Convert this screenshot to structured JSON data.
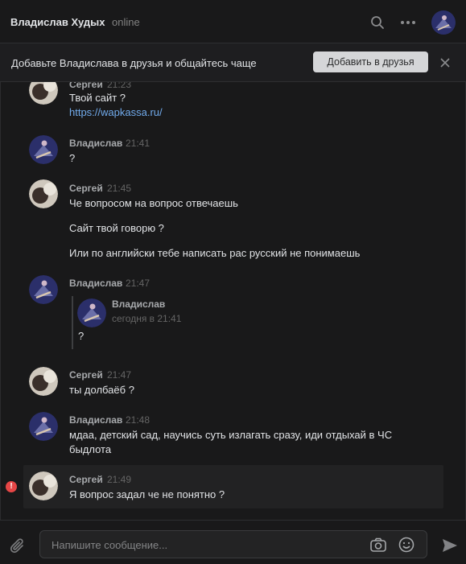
{
  "header": {
    "name": "Владислав Худых",
    "status": "online"
  },
  "banner": {
    "text": "Добавьте Владислава в друзья и общайтесь чаще",
    "button": "Добавить в друзья"
  },
  "messages": [
    {
      "sender": "Сергей",
      "time": "21:23",
      "lines": [
        "Твой сайт ?"
      ],
      "link": "https://wapkassa.ru/"
    },
    {
      "sender": "Владислав",
      "time": "21:41",
      "lines": [
        "?"
      ]
    },
    {
      "sender": "Сергей",
      "time": "21:45",
      "lines": [
        "Че вопросом на вопрос отвечаешь",
        "Сайт твой говорю ?",
        "Или по английски тебе написать рас русский не понимаешь"
      ]
    },
    {
      "sender": "Владислав",
      "time": "21:47",
      "reply": {
        "sender": "Владислав",
        "time": "сегодня в 21:41",
        "text": "?"
      }
    },
    {
      "sender": "Сергей",
      "time": "21:47",
      "lines": [
        "ты долбаёб ?"
      ]
    },
    {
      "sender": "Владислав",
      "time": "21:48",
      "lines": [
        "мдаа, детский сад, научись суть излагать сразу, иди отдыхай в ЧС",
        "быдлота"
      ]
    },
    {
      "sender": "Сергей",
      "time": "21:49",
      "lines": [
        "Я вопрос задал че не понятно ?"
      ]
    }
  ],
  "composer": {
    "placeholder": "Напишите сообщение..."
  },
  "colors": {
    "background": "#19191a",
    "link": "#71aaeb",
    "error": "#e64646"
  }
}
